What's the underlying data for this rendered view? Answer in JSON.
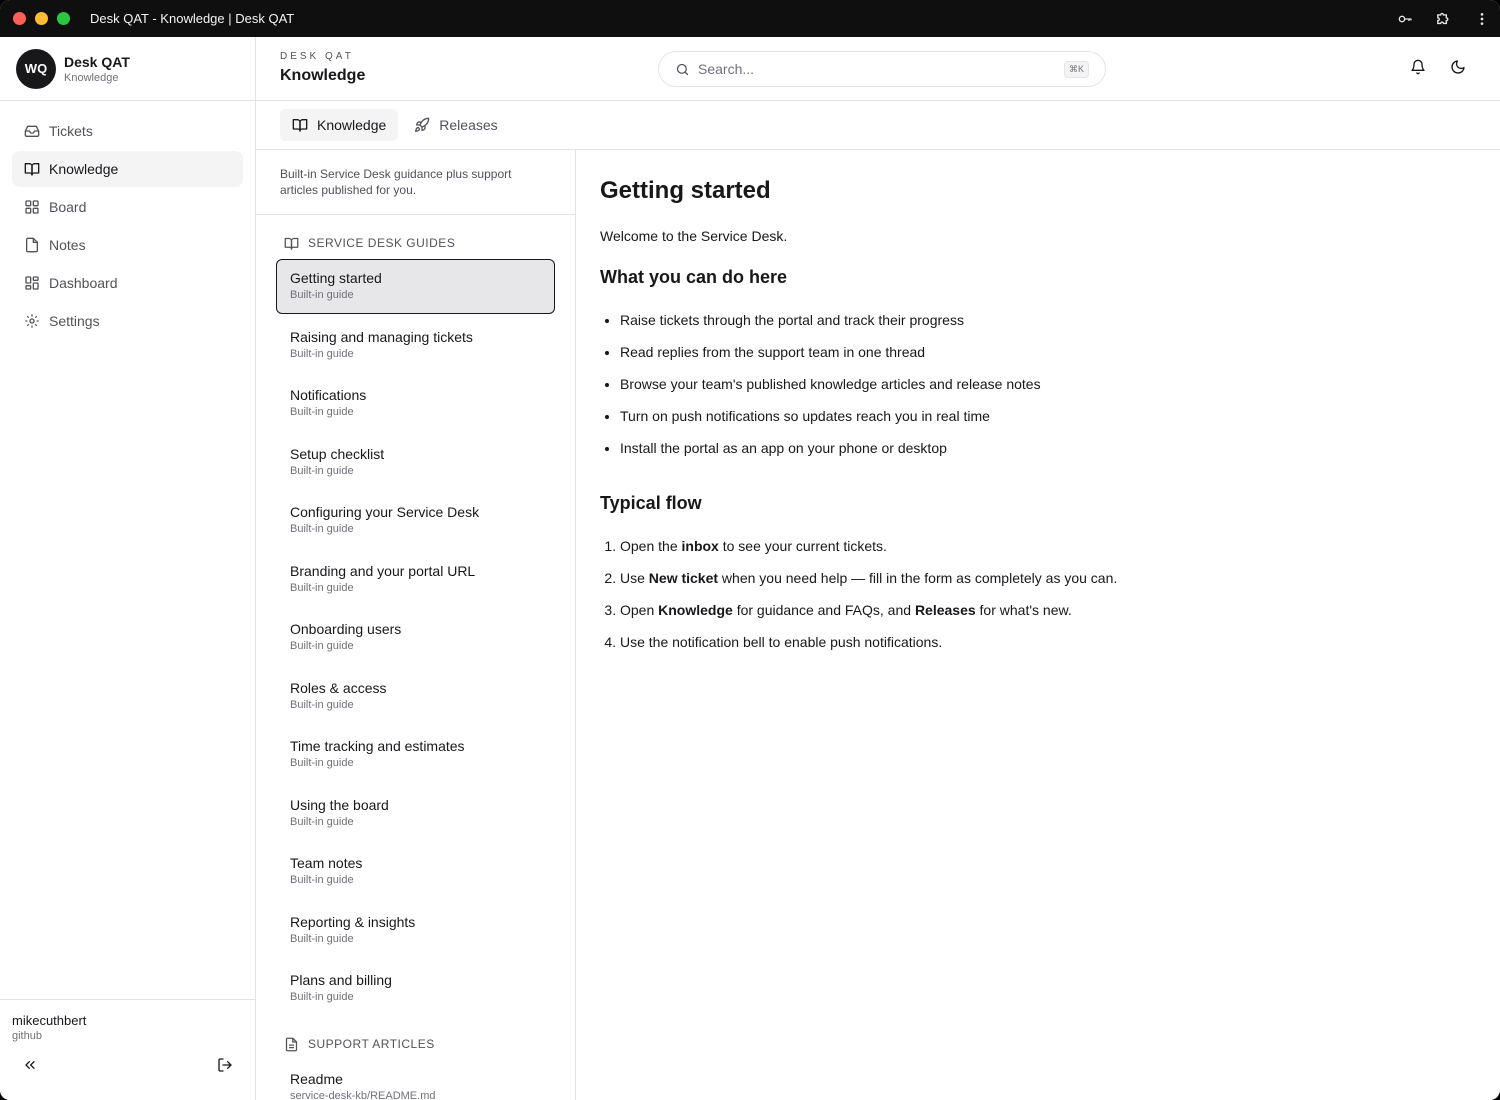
{
  "window": {
    "title": "Desk QAT - Knowledge | Desk QAT"
  },
  "sidebar": {
    "avatar_initials": "WQ",
    "brand_name": "Desk QAT",
    "brand_sub": "Knowledge",
    "items": [
      {
        "label": "Tickets",
        "icon": "inbox-icon"
      },
      {
        "label": "Knowledge",
        "icon": "book-open-icon",
        "active": true
      },
      {
        "label": "Board",
        "icon": "grid-icon"
      },
      {
        "label": "Notes",
        "icon": "file-icon"
      },
      {
        "label": "Dashboard",
        "icon": "layout-dashboard-icon"
      },
      {
        "label": "Settings",
        "icon": "gear-icon"
      }
    ],
    "user": {
      "name": "mikecuthbert",
      "provider": "github"
    }
  },
  "header": {
    "breadcrumb": "DESK QAT",
    "title": "Knowledge",
    "search_placeholder": "Search...",
    "search_shortcut": "⌘K"
  },
  "tabs": [
    {
      "label": "Knowledge",
      "icon": "book-open-icon",
      "active": true
    },
    {
      "label": "Releases",
      "icon": "rocket-icon"
    }
  ],
  "list": {
    "intro": "Built-in Service Desk guidance plus support articles published for you.",
    "guides_heading": "SERVICE DESK GUIDES",
    "guides": [
      {
        "title": "Getting started",
        "sub": "Built-in guide"
      },
      {
        "title": "Raising and managing tickets",
        "sub": "Built-in guide"
      },
      {
        "title": "Notifications",
        "sub": "Built-in guide"
      },
      {
        "title": "Setup checklist",
        "sub": "Built-in guide"
      },
      {
        "title": "Configuring your Service Desk",
        "sub": "Built-in guide"
      },
      {
        "title": "Branding and your portal URL",
        "sub": "Built-in guide"
      },
      {
        "title": "Onboarding users",
        "sub": "Built-in guide"
      },
      {
        "title": "Roles & access",
        "sub": "Built-in guide"
      },
      {
        "title": "Time tracking and estimates",
        "sub": "Built-in guide"
      },
      {
        "title": "Using the board",
        "sub": "Built-in guide"
      },
      {
        "title": "Team notes",
        "sub": "Built-in guide"
      },
      {
        "title": "Reporting & insights",
        "sub": "Built-in guide"
      },
      {
        "title": "Plans and billing",
        "sub": "Built-in guide"
      }
    ],
    "articles_heading": "SUPPORT ARTICLES",
    "articles": [
      {
        "title": "Readme",
        "sub": "service-desk-kb/README.md"
      }
    ]
  },
  "article": {
    "title": "Getting started",
    "intro": "Welcome to the Service Desk.",
    "h_can_do": "What you can do here",
    "bullets": [
      "Raise tickets through the portal and track their progress",
      "Read replies from the support team in one thread",
      "Browse your team's published knowledge articles and release notes",
      "Turn on push notifications so updates reach you in real time",
      "Install the portal as an app on your phone or desktop"
    ],
    "h_flow": "Typical flow",
    "flow": {
      "s1_a": "Open the ",
      "s1_b": "inbox",
      "s1_c": " to see your current tickets.",
      "s2_a": "Use ",
      "s2_b": "New ticket",
      "s2_c": " when you need help — fill in the form as completely as you can.",
      "s3_a": "Open ",
      "s3_b": "Knowledge",
      "s3_c": " for guidance and FAQs, and ",
      "s3_d": "Releases",
      "s3_e": " for what's new.",
      "s4_a": "Use the notification bell to enable push notifications."
    }
  }
}
